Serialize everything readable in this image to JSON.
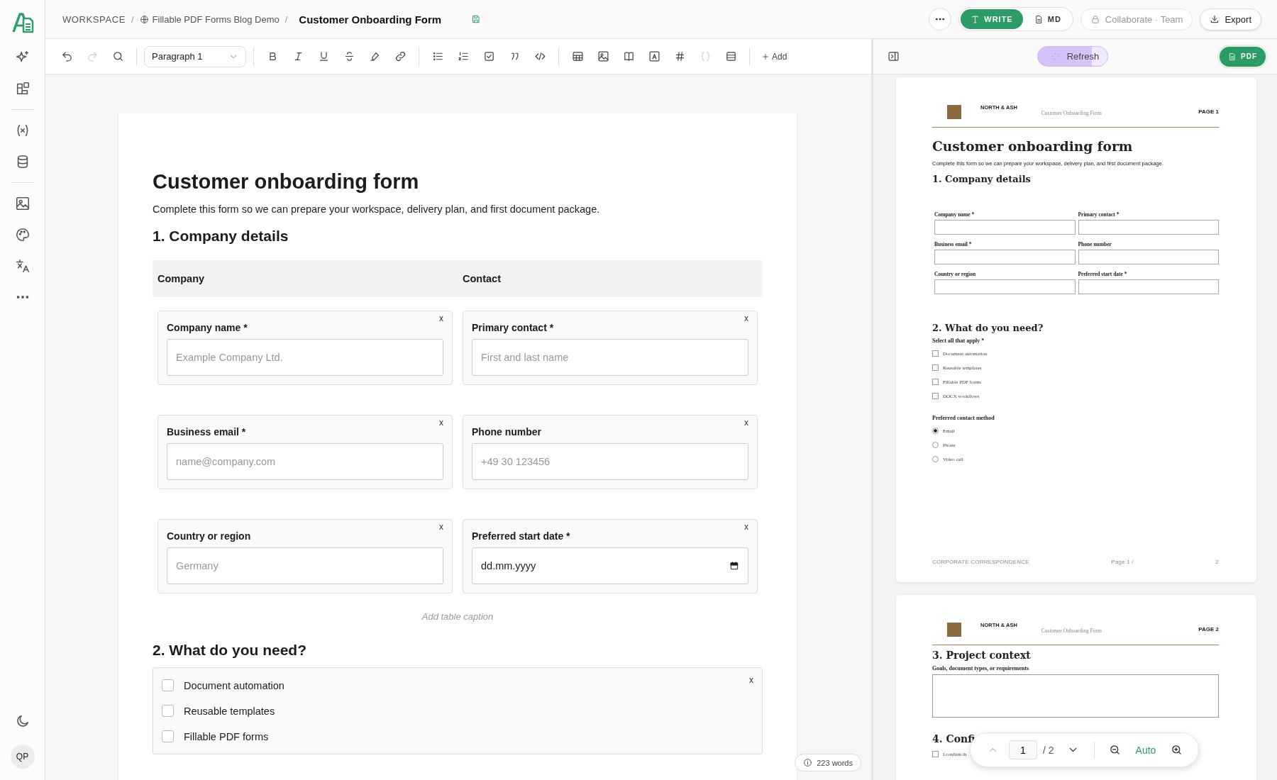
{
  "sidebar": {
    "items": [
      {
        "kind": "sparkle"
      },
      {
        "kind": "blocks"
      },
      {
        "kind": "divider"
      },
      {
        "kind": "variable"
      },
      {
        "kind": "database"
      },
      {
        "kind": "divider"
      },
      {
        "kind": "image"
      },
      {
        "kind": "palette"
      },
      {
        "kind": "translate"
      },
      {
        "kind": "more"
      }
    ],
    "bottom": [
      {
        "kind": "moon"
      }
    ],
    "avatar": "QP"
  },
  "breadcrumb": [
    "WORKSPACE",
    "Fillable PDF Forms Blog Demo"
  ],
  "breadcrumb_separator": "/",
  "document_title": "Customer Onboarding Form",
  "mode_toggle": [
    {
      "label": "WRITE",
      "kind": "write",
      "selected": true
    },
    {
      "label": "MD",
      "kind": "md",
      "selected": false
    }
  ],
  "collaborate": {
    "label": "Collaborate · Team",
    "disabled": true
  },
  "export": "Export",
  "toolbar": [
    {
      "kind": "undo",
      "disabled": false
    },
    {
      "kind": "redo",
      "disabled": true
    },
    {
      "kind": "search",
      "disabled": false
    },
    {
      "kind": "divider"
    },
    {
      "kind": "select",
      "value": "Paragraph 1"
    },
    {
      "kind": "divider"
    },
    {
      "kind": "bold",
      "disabled": false
    },
    {
      "kind": "italic",
      "disabled": false
    },
    {
      "kind": "underline",
      "disabled": false
    },
    {
      "kind": "strike",
      "disabled": false
    },
    {
      "kind": "highlighter",
      "disabled": false
    },
    {
      "kind": "link",
      "disabled": false
    },
    {
      "kind": "divider"
    },
    {
      "kind": "bullets",
      "disabled": false
    },
    {
      "kind": "numbered",
      "disabled": false
    },
    {
      "kind": "checklist",
      "disabled": false
    },
    {
      "kind": "quote",
      "disabled": false
    },
    {
      "kind": "code",
      "disabled": false
    },
    {
      "kind": "divider"
    },
    {
      "kind": "table",
      "disabled": false
    },
    {
      "kind": "image",
      "disabled": false
    },
    {
      "kind": "book",
      "disabled": false
    },
    {
      "kind": "fontbox",
      "disabled": false
    },
    {
      "kind": "hash",
      "disabled": false
    },
    {
      "kind": "braces",
      "disabled": true
    },
    {
      "kind": "rows",
      "disabled": false
    },
    {
      "kind": "divider"
    },
    {
      "kind": "add",
      "label": "Add"
    }
  ],
  "editor": {
    "title": "Customer onboarding form",
    "intro": "Complete this form so we can prepare your workspace, delivery plan, and first document package.",
    "section_1": "1. Company details",
    "table": {
      "columns": [
        "Company",
        "Contact"
      ],
      "fields": [
        {
          "label": "Company name *",
          "kind": "text",
          "placeholder": "Example Company Ltd.",
          "remove": "x"
        },
        {
          "label": "Primary contact *",
          "kind": "text",
          "placeholder": "First and last name",
          "remove": "x"
        },
        {
          "label": "Business email *",
          "kind": "text",
          "placeholder": "name@company.com",
          "remove": "x"
        },
        {
          "label": "Phone number",
          "kind": "text",
          "placeholder": "+49 30 123456",
          "remove": "x"
        },
        {
          "label": "Country or region",
          "kind": "text",
          "placeholder": "Germany",
          "remove": "x"
        },
        {
          "label": "Preferred start date *",
          "kind": "date",
          "value": "dd.mm.yyyy",
          "remove": "x"
        }
      ],
      "caption_placeholder": "Add table caption"
    },
    "section_2": "2. What do you need?",
    "checkbox_group": {
      "remove": "x",
      "options": [
        {
          "label": "Document automation",
          "checked": false
        },
        {
          "label": "Reusable templates",
          "checked": false
        },
        {
          "label": "Fillable PDF forms",
          "checked": false
        }
      ]
    },
    "word_count": "223 words"
  },
  "preview": {
    "refresh": "Refresh",
    "pdf_button": "PDF",
    "pages": [
      {
        "brand": "NORTH & ASH",
        "doc_title": "Customer Onboarding Form",
        "page_label": "PAGE 1",
        "blocks": [
          {
            "kind": "title",
            "text": "Customer onboarding form"
          },
          {
            "kind": "para",
            "text": "Complete this form so we can prepare your workspace, delivery plan, and first document package."
          },
          {
            "kind": "heading",
            "text": "1. Company details"
          },
          {
            "kind": "fields",
            "items": [
              "Company name *",
              "Primary contact *",
              "Business email *",
              "Phone number",
              "Country or region",
              "Preferred start date *"
            ]
          },
          {
            "kind": "heading",
            "text": "2. What do you need?"
          },
          {
            "kind": "label",
            "text": "Select all that apply *"
          },
          {
            "kind": "checks",
            "items": [
              {
                "label": "Document automation",
                "checked": false
              },
              {
                "label": "Reusable templates",
                "checked": false
              },
              {
                "label": "Fillable PDF forms",
                "checked": false
              },
              {
                "label": "DOCX workflows",
                "checked": false
              }
            ]
          },
          {
            "kind": "label",
            "text": "Preferred contact method"
          },
          {
            "kind": "radios",
            "items": [
              {
                "label": "Email",
                "selected": true
              },
              {
                "label": "Phone",
                "selected": false
              },
              {
                "label": "Video call",
                "selected": false
              }
            ]
          }
        ],
        "footer": [
          "CORPORATE CORRESPONDENCE",
          "Page 1 /",
          "2"
        ]
      },
      {
        "brand": "NORTH & ASH",
        "doc_title": "Customer Onboarding Form",
        "page_label": "PAGE 2",
        "blocks": [
          {
            "kind": "heading",
            "text": "3. Project context"
          },
          {
            "kind": "label",
            "text": "Goals, document types, or requirements"
          },
          {
            "kind": "textarea"
          },
          {
            "kind": "heading",
            "text": "4. Confi"
          },
          {
            "kind": "checks",
            "items": [
              {
                "label": "I confirm th",
                "checked": false
              }
            ]
          }
        ]
      }
    ],
    "pager": {
      "page": "1",
      "total": "/ 2",
      "zoom": "Auto"
    }
  }
}
